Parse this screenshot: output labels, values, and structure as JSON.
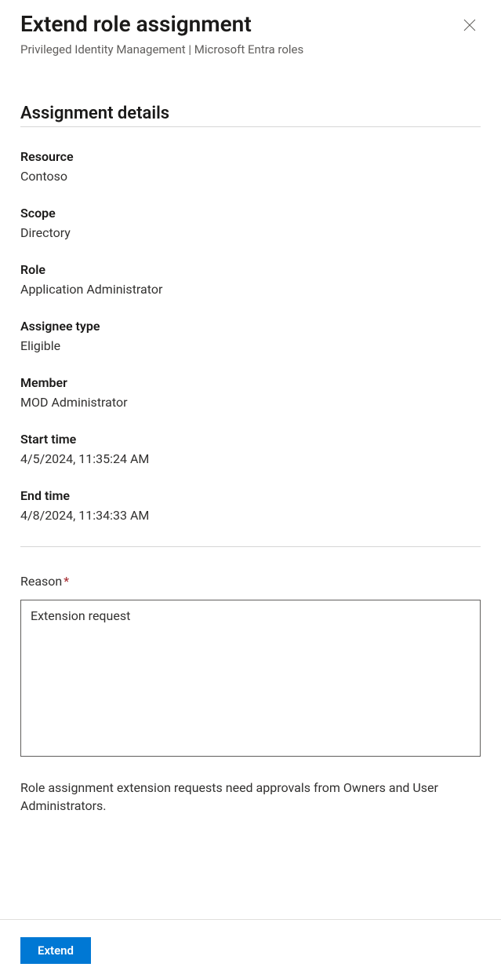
{
  "header": {
    "title": "Extend role assignment",
    "subtitle": "Privileged Identity Management | Microsoft Entra roles"
  },
  "section_title": "Assignment details",
  "fields": {
    "resource_label": "Resource",
    "resource_value": "Contoso",
    "scope_label": "Scope",
    "scope_value": "Directory",
    "role_label": "Role",
    "role_value": "Application Administrator",
    "assignee_type_label": "Assignee type",
    "assignee_type_value": "Eligible",
    "member_label": "Member",
    "member_value": "MOD Administrator",
    "start_time_label": "Start time",
    "start_time_value": "4/5/2024, 11:35:24 AM",
    "end_time_label": "End time",
    "end_time_value": "4/8/2024, 11:34:33 AM"
  },
  "reason": {
    "label": "Reason",
    "required_marker": "*",
    "value": "Extension request"
  },
  "info_text": "Role assignment extension requests need approvals from Owners and User Administrators.",
  "footer": {
    "extend_label": "Extend"
  }
}
